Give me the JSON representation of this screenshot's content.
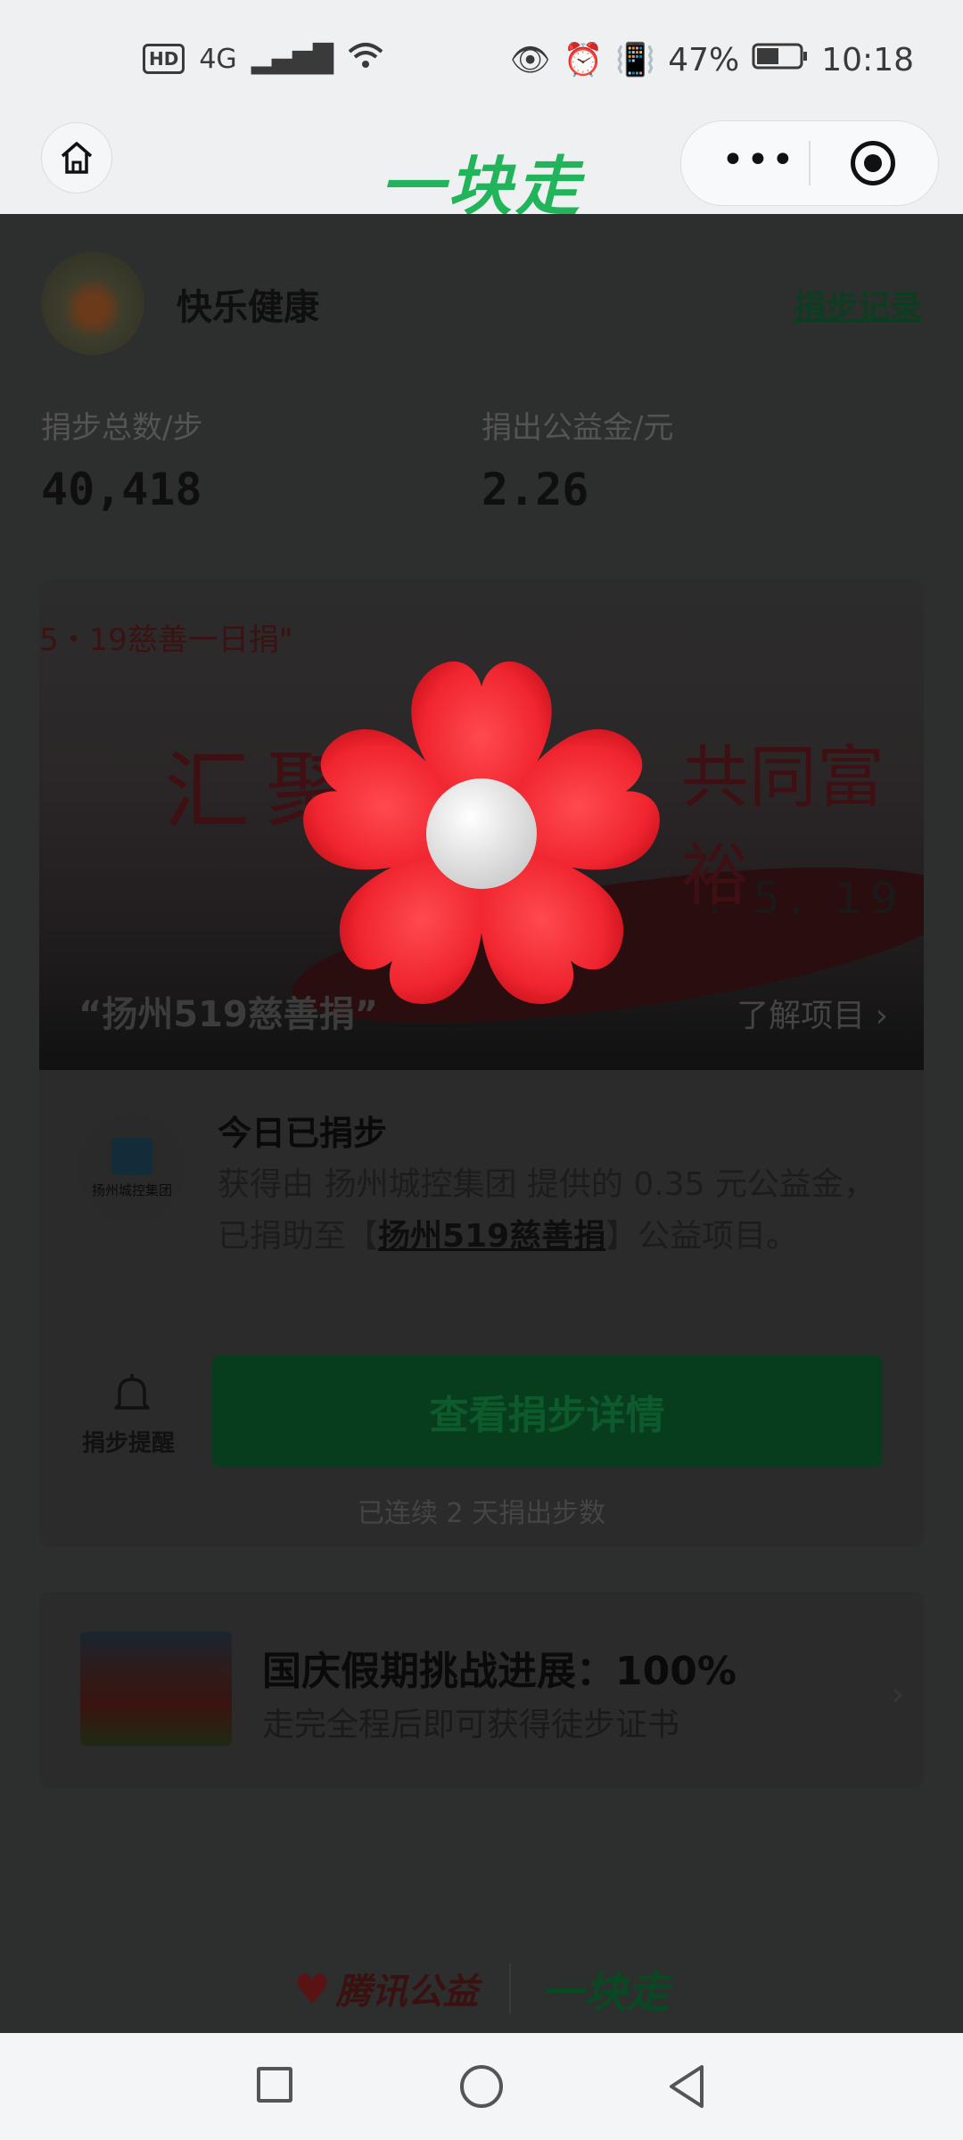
{
  "status_bar": {
    "hd": "HD",
    "network": "4G",
    "battery": "47%",
    "time": "10:18"
  },
  "header": {
    "title": "一块走",
    "more_label": "•••"
  },
  "profile": {
    "username": "快乐健康",
    "record_link": "捐步记录"
  },
  "stats": {
    "steps_label": "捐步总数/步",
    "steps_value": "40,418",
    "fund_label": "捐出公益金/元",
    "fund_value": "2.26"
  },
  "banner": {
    "tag": "5・19慈善一日捐\"",
    "calligraphy_left": "汇聚",
    "calligraphy_right": "共同富裕",
    "date": ". 5. 19",
    "project_title": "“扬州519慈善捐”",
    "learn_more": "了解项目 ›"
  },
  "today": {
    "title": "今日已捐步",
    "desc_prefix": "获得由 扬州城控集团 提供的 0.35 元公益金，已捐助至【",
    "project_link": "扬州519慈善捐",
    "desc_suffix": "】公益项目。",
    "org_logo_text": "扬州城控集团",
    "reminder_label": "捐步提醒",
    "detail_button": "查看捐步详情",
    "streak_text": "已连续 2 天捐出步数"
  },
  "challenge": {
    "title": "国庆假期挑战进展：100%",
    "subtitle": "走完全程后即可获得徒步证书",
    "chevron": "›"
  },
  "footer": {
    "tencent_logo": "腾讯公益",
    "app_logo": "一块走"
  },
  "colors": {
    "brand_green": "#22b45a",
    "overlay_flower": "#f0252f"
  }
}
